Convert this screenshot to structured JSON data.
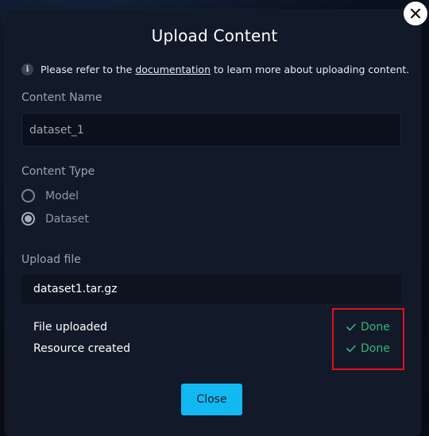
{
  "dialog": {
    "title": "Upload Content",
    "info": {
      "prefix": "Please refer to the",
      "link": "documentation",
      "suffix": "to learn more about uploading content."
    }
  },
  "content_name": {
    "label": "Content Name",
    "value": "dataset_1"
  },
  "content_type": {
    "label": "Content Type",
    "options": [
      {
        "label": "Model",
        "selected": false
      },
      {
        "label": "Dataset",
        "selected": true
      }
    ]
  },
  "upload_file": {
    "label": "Upload file",
    "filename": "dataset1.tar.gz"
  },
  "status": [
    {
      "label": "File uploaded",
      "state": "Done"
    },
    {
      "label": "Resource created",
      "state": "Done"
    }
  ],
  "actions": {
    "close_label": "Close"
  },
  "colors": {
    "accent": "#12b8f2",
    "success": "#34b67a",
    "highlight": "#e3101d"
  },
  "icons": {
    "close": "close-icon",
    "info": "info-icon",
    "check": "check-icon"
  }
}
